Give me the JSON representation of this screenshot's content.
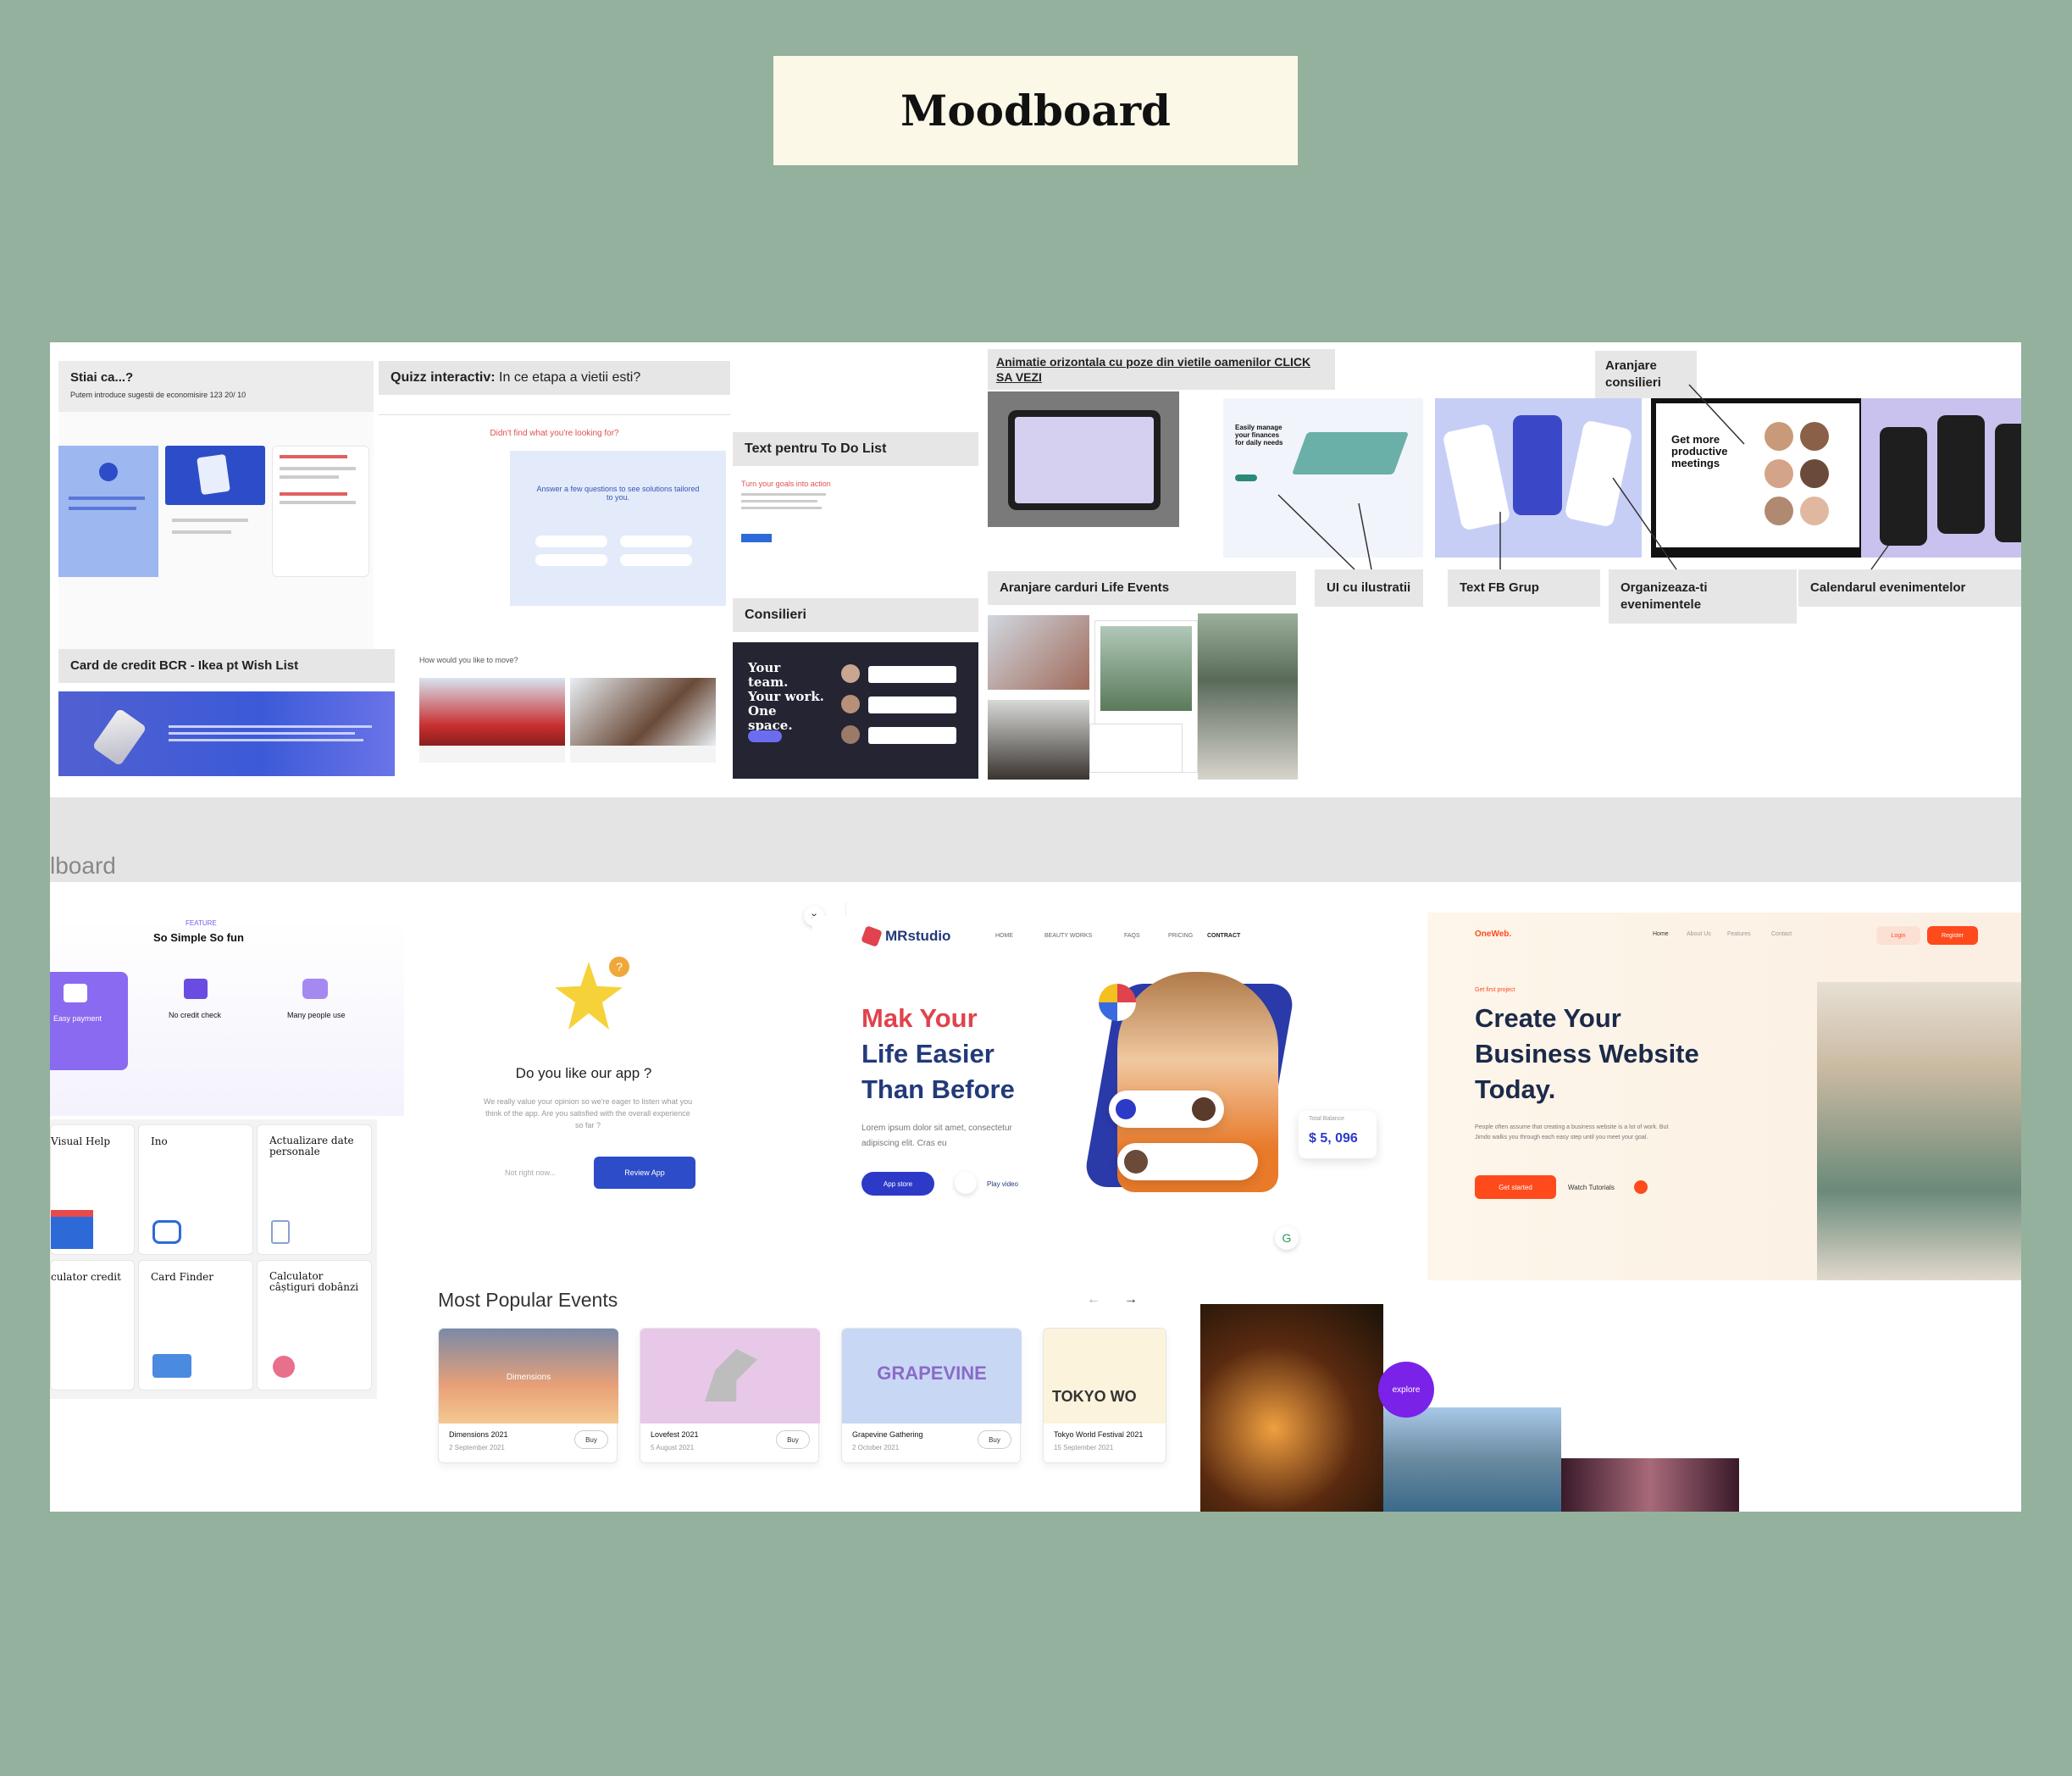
{
  "title": "Moodboard",
  "board1": {
    "stiai_title": "Stiai ca...?",
    "stiai_sub": "Putem introduce sugestii de economisire 123 20/ 10",
    "quiz_title": "Quizz interactiv:",
    "quiz_rest": "In ce etapa a vietii esti?",
    "quiz_link": "Didn't find what you're looking for?",
    "quiz_answer": "Answer a few questions to see solutions tailored to you.",
    "todo_title": "Text pentru To Do List",
    "todo_sub": "Turn your goals into action",
    "consilieri_title": "Consilieri",
    "consilieri_headline": "Your team. Your work. One space.",
    "card_credit_title": "Card de credit BCR - Ikea pt Wish List",
    "how_pay": "How would you like to move?",
    "anim_title": "Animatie orizontala cu poze din vietile oamenilor CLICK SA VEZI",
    "aranjare_carduri": "Aranjare carduri Life Events",
    "aranjare_consilieri": "Aranjare consilieri",
    "ui_ilustratii": "UI cu ilustratii",
    "text_fb": "Text FB Grup",
    "organizeaza": "Organizeaza-ti evenimentele",
    "calendarul": "Calendarul evenimentelor",
    "get_more": "Get more productive meetings",
    "easily_manage": "Easily manage your finances for daily needs"
  },
  "band_label": "lboard",
  "board2": {
    "feature_small": "FEATURE",
    "so_simple": "So Simple So fun",
    "easy_payment": "Easy payment",
    "no_credit_check": "No credit check",
    "many_people": "Many people use",
    "tiles": [
      "Visual Help",
      "Ino",
      "Actualizare date personale",
      "culator credit",
      "Card Finder",
      "Calculator câștiguri dobânzi"
    ],
    "do_you_like": "Do you like our app ?",
    "feedback_text": "We really value your opinion so we're eager to listen what you think of the app. Are you satisfied with the overall experience so far ?",
    "not_right_now": "Not right now...",
    "review_app": "Review App",
    "mrstudio": "MRstudio",
    "nav": [
      "HOME",
      "BEAUTY WORKS",
      "FAQS",
      "PRICING",
      "CONTRACT"
    ],
    "hero_line1": "Mak Your",
    "hero_line2": "Life Easier",
    "hero_line3": "Than Before",
    "hero_body": "Lorem ipsum dolor sit amet, consectetur adipiscing elit. Cras eu",
    "app_store": "App store",
    "play_video": "Play video",
    "balance": "$ 5, 096",
    "balance_label": "Total Balance",
    "onweb": "OneWeb.",
    "onweb_nav": [
      "Home",
      "About Us",
      "Features",
      "Contact"
    ],
    "login": "Login",
    "register": "Register",
    "get_first": "Get first project",
    "create1": "Create Your",
    "create2": "Business Website",
    "create3": "Today.",
    "create_body": "People often assume that creating a business website is a lot of work. But Jimdo walks you through each easy step until you meet your goal.",
    "get_started": "Get started",
    "watch_tutorials": "Watch Tutorials",
    "most_popular": "Most Popular Events",
    "events": [
      {
        "name": "Dimensions 2021",
        "date": "2 September 2021",
        "buy": "Buy",
        "art": "Dimensions"
      },
      {
        "name": "Lovefest 2021",
        "date": "5 August 2021",
        "buy": "Buy",
        "art": ""
      },
      {
        "name": "Grapevine Gathering",
        "date": "2 October 2021",
        "buy": "Buy",
        "art": "GRAPEVINE"
      },
      {
        "name": "Tokyo World Festival 2021",
        "date": "15 September 2021",
        "buy": "",
        "art": "TOKYO WO"
      }
    ],
    "explore": "explore"
  },
  "colors": {
    "background": "#93b19c",
    "title_box": "#fcf8e8",
    "primary_blue": "#2d4cc8",
    "hero_red": "#e0434d",
    "hero_navy": "#233a7a",
    "orange": "#ff4a1c",
    "purple": "#6a4ce0"
  }
}
